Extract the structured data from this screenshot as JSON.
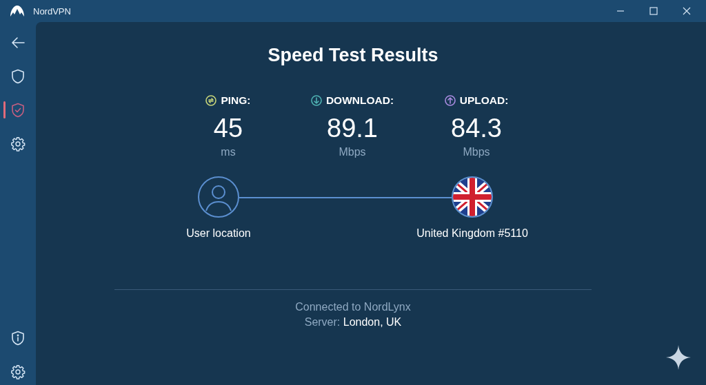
{
  "window": {
    "title": "NordVPN"
  },
  "sidebar": {
    "items": [
      {
        "kind": "back",
        "selected": false
      },
      {
        "kind": "shield",
        "selected": false
      },
      {
        "kind": "shield-check",
        "selected": true
      },
      {
        "kind": "settings",
        "selected": false
      }
    ],
    "bottom_items": [
      {
        "kind": "info",
        "selected": false
      },
      {
        "kind": "settings",
        "selected": false
      }
    ]
  },
  "heading": "Speed Test Results",
  "stats": [
    {
      "kind": "ping",
      "color": "#c8d67a",
      "label": "PING:",
      "value": "45",
      "unit": "ms"
    },
    {
      "kind": "download",
      "color": "#4fb3b3",
      "label": "DOWNLOAD:",
      "value": "89.1",
      "unit": "Mbps"
    },
    {
      "kind": "upload",
      "color": "#a98be0",
      "label": "UPLOAD:",
      "value": "84.3",
      "unit": "Mbps"
    }
  ],
  "connection": {
    "from": "User location",
    "to": "United Kingdom #5110"
  },
  "footer": {
    "protocol": "Connected to NordLynx",
    "server_label": "Server:",
    "server_value": "London, UK"
  }
}
